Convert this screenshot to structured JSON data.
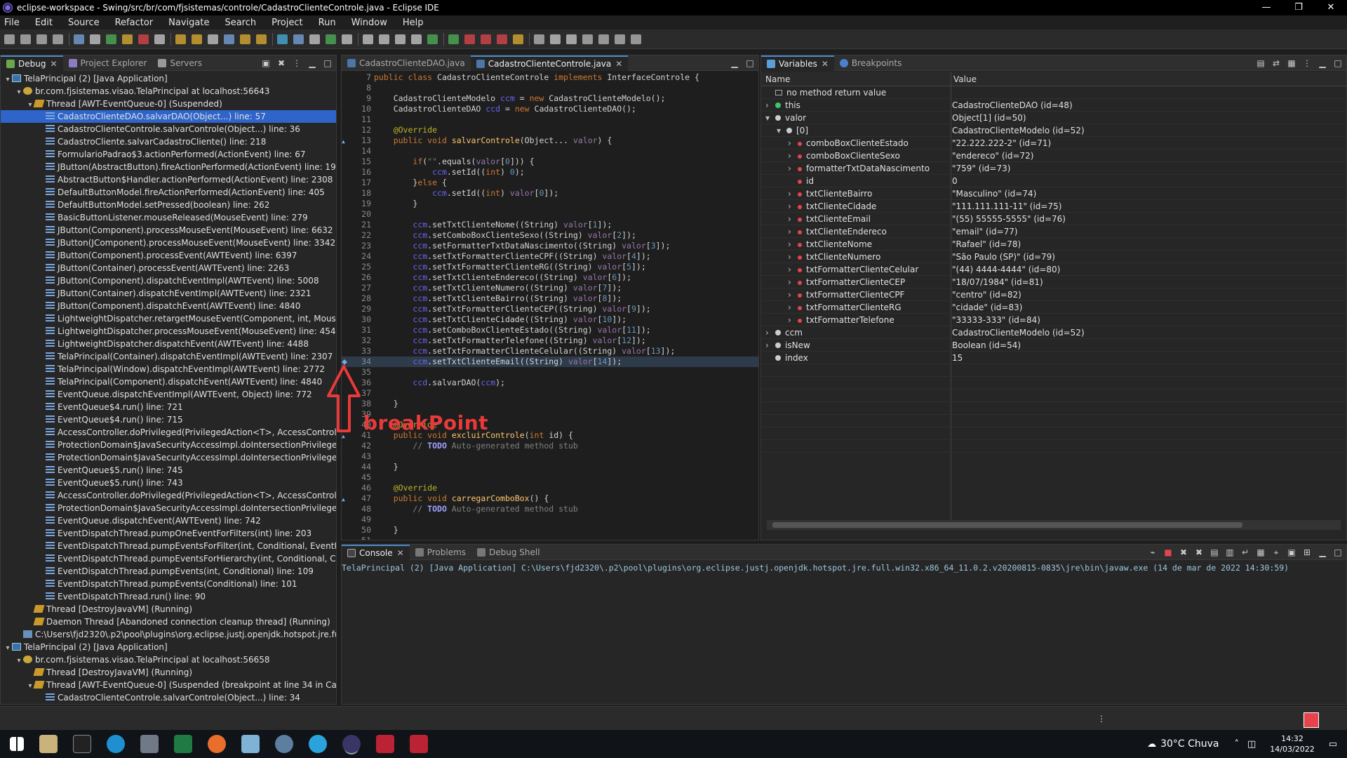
{
  "window": {
    "title": "eclipse-workspace - Swing/src/br/com/fjsistemas/controle/CadastroClienteControle.java - Eclipse IDE",
    "buttons": [
      "—",
      "❐",
      "✕"
    ]
  },
  "menu": [
    "File",
    "Edit",
    "Source",
    "Refactor",
    "Navigate",
    "Search",
    "Project",
    "Run",
    "Window",
    "Help"
  ],
  "left_tabs": [
    {
      "label": "Debug",
      "active": true
    },
    {
      "label": "Project Explorer",
      "active": false
    },
    {
      "label": "Servers",
      "active": false
    }
  ],
  "debug_tree": [
    {
      "indent": 0,
      "arrow": "▾",
      "icon": "app",
      "text": "TelaPrincipal (2) [Java Application]"
    },
    {
      "indent": 1,
      "arrow": "▾",
      "icon": "vm",
      "text": "br.com.fjsistemas.visao.TelaPrincipal at localhost:56643"
    },
    {
      "indent": 2,
      "arrow": "▾",
      "icon": "thread",
      "text": "Thread [AWT-EventQueue-0] (Suspended)"
    },
    {
      "indent": 3,
      "arrow": "",
      "icon": "frame",
      "text": "CadastroClienteDAO.salvarDAO(Object...) line: 57",
      "selected": true
    },
    {
      "indent": 3,
      "arrow": "",
      "icon": "frame",
      "text": "CadastroClienteControle.salvarControle(Object...) line: 36"
    },
    {
      "indent": 3,
      "arrow": "",
      "icon": "frame",
      "text": "CadastroCliente.salvarCadastroCliente() line: 218"
    },
    {
      "indent": 3,
      "arrow": "",
      "icon": "frame",
      "text": "FormularioPadrao$3.actionPerformed(ActionEvent) line: 67"
    },
    {
      "indent": 3,
      "arrow": "",
      "icon": "frame",
      "text": "JButton(AbstractButton).fireActionPerformed(ActionEvent) line: 1967"
    },
    {
      "indent": 3,
      "arrow": "",
      "icon": "frame",
      "text": "AbstractButton$Handler.actionPerformed(ActionEvent) line: 2308"
    },
    {
      "indent": 3,
      "arrow": "",
      "icon": "frame",
      "text": "DefaultButtonModel.fireActionPerformed(ActionEvent) line: 405"
    },
    {
      "indent": 3,
      "arrow": "",
      "icon": "frame",
      "text": "DefaultButtonModel.setPressed(boolean) line: 262"
    },
    {
      "indent": 3,
      "arrow": "",
      "icon": "frame",
      "text": "BasicButtonListener.mouseReleased(MouseEvent) line: 279"
    },
    {
      "indent": 3,
      "arrow": "",
      "icon": "frame",
      "text": "JButton(Component).processMouseEvent(MouseEvent) line: 6632"
    },
    {
      "indent": 3,
      "arrow": "",
      "icon": "frame",
      "text": "JButton(JComponent).processMouseEvent(MouseEvent) line: 3342"
    },
    {
      "indent": 3,
      "arrow": "",
      "icon": "frame",
      "text": "JButton(Component).processEvent(AWTEvent) line: 6397"
    },
    {
      "indent": 3,
      "arrow": "",
      "icon": "frame",
      "text": "JButton(Container).processEvent(AWTEvent) line: 2263"
    },
    {
      "indent": 3,
      "arrow": "",
      "icon": "frame",
      "text": "JButton(Component).dispatchEventImpl(AWTEvent) line: 5008"
    },
    {
      "indent": 3,
      "arrow": "",
      "icon": "frame",
      "text": "JButton(Container).dispatchEventImpl(AWTEvent) line: 2321"
    },
    {
      "indent": 3,
      "arrow": "",
      "icon": "frame",
      "text": "JButton(Component).dispatchEvent(AWTEvent) line: 4840"
    },
    {
      "indent": 3,
      "arrow": "",
      "icon": "frame",
      "text": "LightweightDispatcher.retargetMouseEvent(Component, int, MouseEven"
    },
    {
      "indent": 3,
      "arrow": "",
      "icon": "frame",
      "text": "LightweightDispatcher.processMouseEvent(MouseEvent) line: 4547"
    },
    {
      "indent": 3,
      "arrow": "",
      "icon": "frame",
      "text": "LightweightDispatcher.dispatchEvent(AWTEvent) line: 4488"
    },
    {
      "indent": 3,
      "arrow": "",
      "icon": "frame",
      "text": "TelaPrincipal(Container).dispatchEventImpl(AWTEvent) line: 2307"
    },
    {
      "indent": 3,
      "arrow": "",
      "icon": "frame",
      "text": "TelaPrincipal(Window).dispatchEventImpl(AWTEvent) line: 2772"
    },
    {
      "indent": 3,
      "arrow": "",
      "icon": "frame",
      "text": "TelaPrincipal(Component).dispatchEvent(AWTEvent) line: 4840"
    },
    {
      "indent": 3,
      "arrow": "",
      "icon": "frame",
      "text": "EventQueue.dispatchEventImpl(AWTEvent, Object) line: 772"
    },
    {
      "indent": 3,
      "arrow": "",
      "icon": "frame",
      "text": "EventQueue$4.run() line: 721"
    },
    {
      "indent": 3,
      "arrow": "",
      "icon": "frame",
      "text": "EventQueue$4.run() line: 715"
    },
    {
      "indent": 3,
      "arrow": "",
      "icon": "frame",
      "text": "AccessController.doPrivileged(PrivilegedAction<T>, AccessControlConte"
    },
    {
      "indent": 3,
      "arrow": "",
      "icon": "frame",
      "text": "ProtectionDomain$JavaSecurityAccessImpl.doIntersectionPrivilege(Privile"
    },
    {
      "indent": 3,
      "arrow": "",
      "icon": "frame",
      "text": "ProtectionDomain$JavaSecurityAccessImpl.doIntersectionPrivilege(Privile"
    },
    {
      "indent": 3,
      "arrow": "",
      "icon": "frame",
      "text": "EventQueue$5.run() line: 745"
    },
    {
      "indent": 3,
      "arrow": "",
      "icon": "frame",
      "text": "EventQueue$5.run() line: 743"
    },
    {
      "indent": 3,
      "arrow": "",
      "icon": "frame",
      "text": "AccessController.doPrivileged(PrivilegedAction<T>, AccessControlConte"
    },
    {
      "indent": 3,
      "arrow": "",
      "icon": "frame",
      "text": "ProtectionDomain$JavaSecurityAccessImpl.doIntersectionPrivilege(Privile"
    },
    {
      "indent": 3,
      "arrow": "",
      "icon": "frame",
      "text": "EventQueue.dispatchEvent(AWTEvent) line: 742"
    },
    {
      "indent": 3,
      "arrow": "",
      "icon": "frame",
      "text": "EventDispatchThread.pumpOneEventForFilters(int) line: 203"
    },
    {
      "indent": 3,
      "arrow": "",
      "icon": "frame",
      "text": "EventDispatchThread.pumpEventsForFilter(int, Conditional, EventFilter) li"
    },
    {
      "indent": 3,
      "arrow": "",
      "icon": "frame",
      "text": "EventDispatchThread.pumpEventsForHierarchy(int, Conditional, Compor"
    },
    {
      "indent": 3,
      "arrow": "",
      "icon": "frame",
      "text": "EventDispatchThread.pumpEvents(int, Conditional) line: 109"
    },
    {
      "indent": 3,
      "arrow": "",
      "icon": "frame",
      "text": "EventDispatchThread.pumpEvents(Conditional) line: 101"
    },
    {
      "indent": 3,
      "arrow": "",
      "icon": "frame",
      "text": "EventDispatchThread.run() line: 90"
    },
    {
      "indent": 2,
      "arrow": "",
      "icon": "thread",
      "text": "Thread [DestroyJavaVM] (Running)"
    },
    {
      "indent": 2,
      "arrow": "",
      "icon": "thread",
      "text": "Daemon Thread [Abandoned connection cleanup thread] (Running)"
    },
    {
      "indent": 1,
      "arrow": "",
      "icon": "proc",
      "text": "C:\\Users\\fjd2320\\.p2\\pool\\plugins\\org.eclipse.justj.openjdk.hotspot.jre.full.win"
    },
    {
      "indent": 0,
      "arrow": "▾",
      "icon": "app",
      "text": "TelaPrincipal (2) [Java Application]"
    },
    {
      "indent": 1,
      "arrow": "▾",
      "icon": "vm",
      "text": "br.com.fjsistemas.visao.TelaPrincipal at localhost:56658"
    },
    {
      "indent": 2,
      "arrow": "",
      "icon": "thread",
      "text": "Thread [DestroyJavaVM] (Running)"
    },
    {
      "indent": 2,
      "arrow": "▾",
      "icon": "thread",
      "text": "Thread [AWT-EventQueue-0] (Suspended (breakpoint at line 34 in CadastroC"
    },
    {
      "indent": 3,
      "arrow": "",
      "icon": "frame",
      "text": "CadastroClienteControle.salvarControle(Object...) line: 34"
    }
  ],
  "editor_tabs": [
    {
      "label": "CadastroClienteDAO.java",
      "active": false
    },
    {
      "label": "CadastroClienteControle.java",
      "active": true
    }
  ],
  "code_lines": [
    {
      "n": "7",
      "html": "<span class=\"kw\">public class</span> CadastroClienteControle <span class=\"kw\">implements</span> InterfaceControle {"
    },
    {
      "n": "8",
      "html": ""
    },
    {
      "n": "9",
      "html": "    CadastroClienteModelo <span class=\"fld\">ccm</span> = <span class=\"kw\">new</span> CadastroClienteModelo();"
    },
    {
      "n": "10",
      "html": "    CadastroClienteDAO <span class=\"fld\">ccd</span> = <span class=\"kw\">new</span> CadastroClienteDAO();"
    },
    {
      "n": "11",
      "html": ""
    },
    {
      "n": "12",
      "html": "    <span class=\"ann\">@Override</span>"
    },
    {
      "n": "13",
      "html": "    <span class=\"kw\">public void</span> <span class=\"mth\">salvarControle</span>(Object... <span class=\"fldp\">valor</span>) {"
    },
    {
      "n": "14",
      "html": ""
    },
    {
      "n": "15",
      "html": "        <span class=\"kw\">if</span>(<span class=\"str\">\"\"</span>.equals(<span class=\"fldp\">valor</span>[<span class=\"num\">0</span>])) {"
    },
    {
      "n": "16",
      "html": "            <span class=\"fld\">ccm</span>.setId((<span class=\"kw\">int</span>) <span class=\"num\">0</span>);"
    },
    {
      "n": "17",
      "html": "        }<span class=\"kw\">else</span> {"
    },
    {
      "n": "18",
      "html": "            <span class=\"fld\">ccm</span>.setId((<span class=\"kw\">int</span>) <span class=\"fldp\">valor</span>[<span class=\"num\">0</span>]);"
    },
    {
      "n": "19",
      "html": "        }"
    },
    {
      "n": "20",
      "html": ""
    },
    {
      "n": "21",
      "html": "        <span class=\"fld\">ccm</span>.setTxtClienteNome((String) <span class=\"fldp\">valor</span>[<span class=\"num\">1</span>]);"
    },
    {
      "n": "22",
      "html": "        <span class=\"fld\">ccm</span>.setComboBoxClienteSexo((String) <span class=\"fldp\">valor</span>[<span class=\"num\">2</span>]);"
    },
    {
      "n": "23",
      "html": "        <span class=\"fld\">ccm</span>.setFormatterTxtDataNascimento((String) <span class=\"fldp\">valor</span>[<span class=\"num\">3</span>]);"
    },
    {
      "n": "24",
      "html": "        <span class=\"fld\">ccm</span>.setTxtFormatterClienteCPF((String) <span class=\"fldp\">valor</span>[<span class=\"num\">4</span>]);"
    },
    {
      "n": "25",
      "html": "        <span class=\"fld\">ccm</span>.setTxtFormatterClienteRG((String) <span class=\"fldp\">valor</span>[<span class=\"num\">5</span>]);"
    },
    {
      "n": "26",
      "html": "        <span class=\"fld\">ccm</span>.setTxtClienteEndereco((String) <span class=\"fldp\">valor</span>[<span class=\"num\">6</span>]);"
    },
    {
      "n": "27",
      "html": "        <span class=\"fld\">ccm</span>.setTxtClienteNumero((String) <span class=\"fldp\">valor</span>[<span class=\"num\">7</span>]);"
    },
    {
      "n": "28",
      "html": "        <span class=\"fld\">ccm</span>.setTxtClienteBairro((String) <span class=\"fldp\">valor</span>[<span class=\"num\">8</span>]);"
    },
    {
      "n": "29",
      "html": "        <span class=\"fld\">ccm</span>.setTxtFormatterClienteCEP((String) <span class=\"fldp\">valor</span>[<span class=\"num\">9</span>]);"
    },
    {
      "n": "30",
      "html": "        <span class=\"fld\">ccm</span>.setTxtClienteCidade((String) <span class=\"fldp\">valor</span>[<span class=\"num\">10</span>]);"
    },
    {
      "n": "31",
      "html": "        <span class=\"fld\">ccm</span>.setComboBoxClienteEstado((String) <span class=\"fldp\">valor</span>[<span class=\"num\">11</span>]);"
    },
    {
      "n": "32",
      "html": "        <span class=\"fld\">ccm</span>.setTxtFormatterTelefone((String) <span class=\"fldp\">valor</span>[<span class=\"num\">12</span>]);"
    },
    {
      "n": "33",
      "html": "        <span class=\"fld\">ccm</span>.setTxtFormatterClienteCelular((String) <span class=\"fldp\">valor</span>[<span class=\"num\">13</span>]);"
    },
    {
      "n": "34",
      "html": "        <span class=\"fld\">ccm</span>.setTxtClienteEmail((String) <span class=\"fldp\">valor</span>[<span class=\"num\">14</span>]);",
      "current": true
    },
    {
      "n": "35",
      "html": ""
    },
    {
      "n": "36",
      "html": "        <span class=\"fld\">ccd</span>.salvarDAO(<span class=\"fld\">ccm</span>);"
    },
    {
      "n": "37",
      "html": ""
    },
    {
      "n": "38",
      "html": "    }"
    },
    {
      "n": "39",
      "html": ""
    },
    {
      "n": "40",
      "html": "    <span class=\"ann\">@Override</span>"
    },
    {
      "n": "41",
      "html": "    <span class=\"kw\">public void</span> <span class=\"mth\">excluirControle</span>(<span class=\"kw\">int</span> id) {"
    },
    {
      "n": "42",
      "html": "        <span class=\"cmt\">// </span><span class=\"todo\">TODO</span><span class=\"cmt\"> Auto-generated method stub</span>"
    },
    {
      "n": "43",
      "html": ""
    },
    {
      "n": "44",
      "html": "    }"
    },
    {
      "n": "45",
      "html": ""
    },
    {
      "n": "46",
      "html": "    <span class=\"ann\">@Override</span>"
    },
    {
      "n": "47",
      "html": "    <span class=\"kw\">public void</span> <span class=\"mth\">carregarComboBox</span>() {"
    },
    {
      "n": "48",
      "html": "        <span class=\"cmt\">// </span><span class=\"todo\">TODO</span><span class=\"cmt\"> Auto-generated method stub</span>"
    },
    {
      "n": "49",
      "html": ""
    },
    {
      "n": "50",
      "html": "    }"
    },
    {
      "n": "51",
      "html": ""
    }
  ],
  "var_tabs": [
    {
      "label": "Variables",
      "active": true
    },
    {
      "label": "Breakpoints",
      "active": false
    }
  ],
  "var_columns": {
    "name": "Name",
    "value": "Value"
  },
  "variables": [
    {
      "indent": 0,
      "arrow": "",
      "dot": "none",
      "name": "no method return value",
      "value": ""
    },
    {
      "indent": 0,
      "arrow": "›",
      "dot": "g",
      "name": "this",
      "value": "CadastroClienteDAO  (id=48)"
    },
    {
      "indent": 0,
      "arrow": "▾",
      "dot": "w",
      "name": "valor",
      "value": "Object[1]  (id=50)"
    },
    {
      "indent": 1,
      "arrow": "▾",
      "dot": "w",
      "name": "[0]",
      "value": "CadastroClienteModelo  (id=52)"
    },
    {
      "indent": 2,
      "arrow": "›",
      "dot": "r",
      "name": "comboBoxClienteEstado",
      "value": "\"22.222.222-2\" (id=71)"
    },
    {
      "indent": 2,
      "arrow": "›",
      "dot": "r",
      "name": "comboBoxClienteSexo",
      "value": "\"endereco\" (id=72)"
    },
    {
      "indent": 2,
      "arrow": "›",
      "dot": "r",
      "name": "formatterTxtDataNascimento",
      "value": "\"759\" (id=73)"
    },
    {
      "indent": 2,
      "arrow": "",
      "dot": "r",
      "name": "id",
      "value": "0"
    },
    {
      "indent": 2,
      "arrow": "›",
      "dot": "r",
      "name": "txtClienteBairro",
      "value": "\"Masculino\" (id=74)"
    },
    {
      "indent": 2,
      "arrow": "›",
      "dot": "r",
      "name": "txtClienteCidade",
      "value": "\"111.111.111-11\" (id=75)"
    },
    {
      "indent": 2,
      "arrow": "›",
      "dot": "r",
      "name": "txtClienteEmail",
      "value": "\"(55) 55555-5555\" (id=76)"
    },
    {
      "indent": 2,
      "arrow": "›",
      "dot": "r",
      "name": "txtClienteEndereco",
      "value": "\"email\" (id=77)"
    },
    {
      "indent": 2,
      "arrow": "›",
      "dot": "r",
      "name": "txtClienteNome",
      "value": "\"Rafael\" (id=78)"
    },
    {
      "indent": 2,
      "arrow": "›",
      "dot": "r",
      "name": "txtClienteNumero",
      "value": "\"São Paulo (SP)\" (id=79)"
    },
    {
      "indent": 2,
      "arrow": "›",
      "dot": "r",
      "name": "txtFormatterClienteCelular",
      "value": "\"(44) 4444-4444\" (id=80)"
    },
    {
      "indent": 2,
      "arrow": "›",
      "dot": "r",
      "name": "txtFormatterClienteCEP",
      "value": "\"18/07/1984\" (id=81)"
    },
    {
      "indent": 2,
      "arrow": "›",
      "dot": "r",
      "name": "txtFormatterClienteCPF",
      "value": "\"centro\" (id=82)"
    },
    {
      "indent": 2,
      "arrow": "›",
      "dot": "r",
      "name": "txtFormatterClienteRG",
      "value": "\"cidade\" (id=83)"
    },
    {
      "indent": 2,
      "arrow": "›",
      "dot": "r",
      "name": "txtFormatterTelefone",
      "value": "\"33333-333\" (id=84)"
    },
    {
      "indent": 0,
      "arrow": "›",
      "dot": "w",
      "name": "ccm",
      "value": "CadastroClienteModelo  (id=52)"
    },
    {
      "indent": 0,
      "arrow": "›",
      "dot": "w",
      "name": "isNew",
      "value": "Boolean  (id=54)"
    },
    {
      "indent": 0,
      "arrow": "",
      "dot": "w",
      "name": "index",
      "value": "15"
    }
  ],
  "console_tabs": [
    {
      "label": "Console",
      "active": true
    },
    {
      "label": "Problems",
      "active": false
    },
    {
      "label": "Debug Shell",
      "active": false
    }
  ],
  "console_line": "TelaPrincipal (2) [Java Application] C:\\Users\\fjd2320\\.p2\\pool\\plugins\\org.eclipse.justj.openjdk.hotspot.jre.full.win32.x86_64_11.0.2.v20200815-0835\\jre\\bin\\javaw.exe  (14 de mar de 2022 14:30:59)",
  "annotation": {
    "label": "breakPoint",
    "color": "#e83a3a"
  },
  "taskbar": {
    "weather": "30°C  Chuva",
    "time": "14:32",
    "date": "14/03/2022"
  },
  "colors": {
    "selection": "#2f65ca",
    "accent": "#4a88c7"
  }
}
